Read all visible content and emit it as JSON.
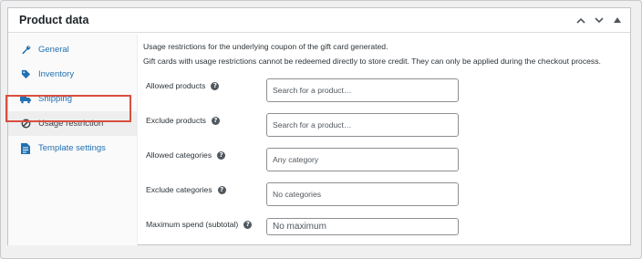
{
  "panel": {
    "title": "Product data",
    "controls": [
      {
        "name": "move-up-icon",
        "glyph": "up-chevron"
      },
      {
        "name": "move-down-icon",
        "glyph": "down-chevron"
      },
      {
        "name": "collapse-icon",
        "glyph": "triangle-up"
      }
    ]
  },
  "sidebar": {
    "items": [
      {
        "label": "General",
        "icon": "wrench-icon",
        "active": false
      },
      {
        "label": "Inventory",
        "icon": "tag-icon",
        "active": false
      },
      {
        "label": "Shipping",
        "icon": "truck-icon",
        "active": false
      },
      {
        "label": "Usage restriction",
        "icon": "no-entry-icon",
        "active": true
      },
      {
        "label": "Template settings",
        "icon": "document-icon",
        "active": false
      }
    ]
  },
  "main": {
    "notice_1": "Usage restrictions for the underlying coupon of the gift card generated.",
    "notice_2": "Gift cards with usage restrictions cannot be redeemed directly to store credit. They can only be applied during the checkout process.",
    "fields": [
      {
        "label": "Allowed products",
        "placeholder": "Search for a product…"
      },
      {
        "label": "Exclude products",
        "placeholder": "Search for a product…"
      },
      {
        "label": "Allowed categories",
        "placeholder": "Any category"
      },
      {
        "label": "Exclude categories",
        "placeholder": "No categories"
      },
      {
        "label": "Maximum spend (subtotal)",
        "placeholder": "No maximum"
      }
    ]
  },
  "colors": {
    "link": "#2271b1",
    "highlight": "#d94f3f"
  }
}
